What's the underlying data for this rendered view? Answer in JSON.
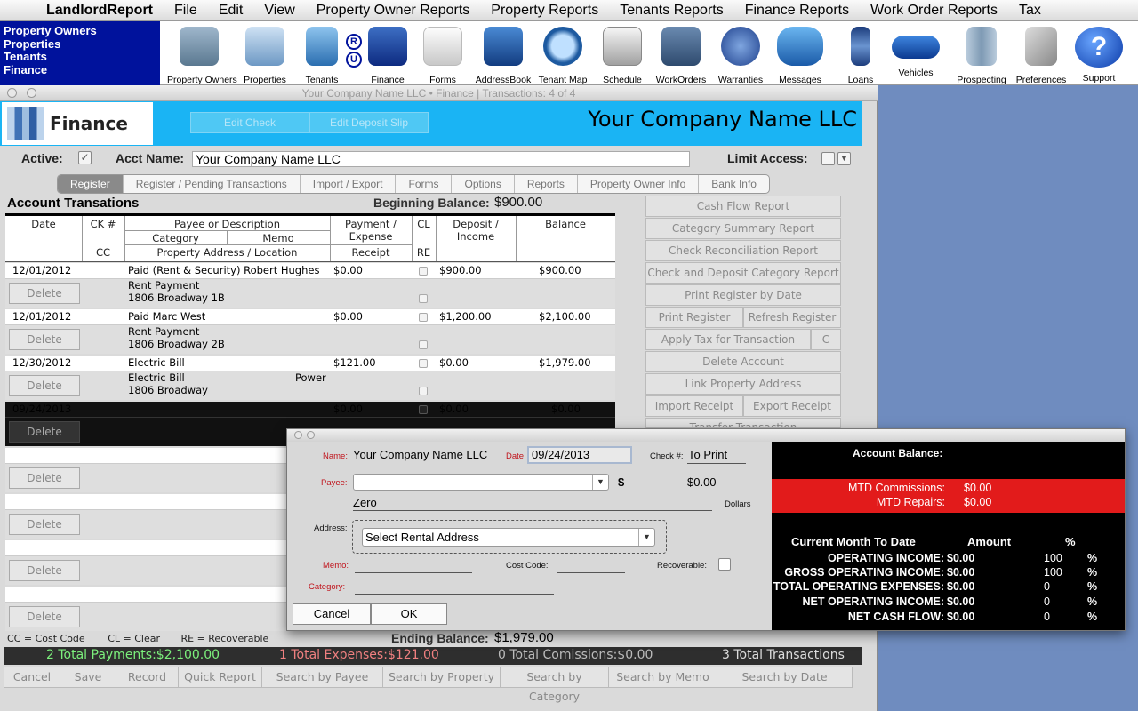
{
  "menubar": {
    "items": [
      "LandlordReport",
      "File",
      "Edit",
      "View",
      "Property Owner Reports",
      "Property Reports",
      "Tenants Reports",
      "Finance Reports",
      "Work Order Reports",
      "Tax"
    ]
  },
  "nav": {
    "items": [
      "Property Owners",
      "Properties",
      "Tenants",
      "Finance"
    ]
  },
  "toolbar": {
    "items": [
      "Property Owners",
      "Properties",
      "Tenants",
      "Finance",
      "Forms",
      "AddressBook",
      "Tenant Map",
      "Schedule",
      "WorkOrders",
      "Warranties",
      "Messages",
      "Loans",
      "Vehicles",
      "Prospecting",
      "Preferences",
      "Support"
    ],
    "ru_badge": [
      "R",
      "U"
    ]
  },
  "window": {
    "title": "Your Company Name LLC  •  Finance | Transactions: 4 of 4"
  },
  "header": {
    "logo_text": "Finance",
    "edit_check": "Edit Check",
    "edit_deposit": "Edit Deposit Slip",
    "company": "Your Company Name LLC"
  },
  "acct": {
    "active_label": "Active:",
    "acct_name_label": "Acct Name:",
    "acct_name": "Your Company Name LLC",
    "limit_label": "Limit Access:",
    "active_check": "✓"
  },
  "tabs": [
    "Register",
    "Register / Pending Transactions",
    "Import / Export",
    "Forms",
    "Options",
    "Reports",
    "Property Owner Info",
    "Bank Info"
  ],
  "register": {
    "title": "Account Transations",
    "beginning_label": "Beginning Balance:",
    "beginning_value": "$900.00",
    "headers": {
      "date": "Date",
      "ck": "CK #",
      "cc": "CC",
      "payee": "Payee or Description",
      "category": "Category",
      "memo": "Memo",
      "address": "Property Address / Location",
      "payment": "Payment /",
      "expense": "Expense",
      "receipt": "Receipt",
      "cl": "CL",
      "re": "RE",
      "deposit": "Deposit /",
      "income": "Income",
      "balance": "Balance"
    },
    "delete_label": "Delete",
    "rows": [
      {
        "date": "12/01/2012",
        "payee": "Paid (Rent & Security) Robert Hughes",
        "payment": "$0.00",
        "deposit": "$900.00",
        "balance": "$900.00",
        "category": "Rent Payment",
        "memo": "",
        "address": "1806 Broadway 1B"
      },
      {
        "date": "12/01/2012",
        "payee": "Paid Marc West",
        "payment": "$0.00",
        "deposit": "$1,200.00",
        "balance": "$2,100.00",
        "category": "Rent Payment",
        "memo": "",
        "address": "1806 Broadway 2B"
      },
      {
        "date": "12/30/2012",
        "payee": "Electric Bill",
        "payment": "$121.00",
        "deposit": "$0.00",
        "balance": "$1,979.00",
        "category": "Electric Bill",
        "memo": "Power",
        "address": "1806 Broadway"
      },
      {
        "date": "09/24/2013",
        "payee": "",
        "payment": "$0.00",
        "deposit": "$0.00",
        "balance": "$0.00",
        "category": "",
        "memo": "",
        "address": ""
      }
    ]
  },
  "right_panel": [
    "Cash Flow Report",
    "Category Summary Report",
    "Check Reconciliation Report",
    "Check and Deposit Category Report",
    "Print Register by Date",
    "Print Register",
    "Refresh Register",
    "Apply Tax for Transaction",
    "C",
    "Delete Account",
    "Link Property Address",
    "Import Receipt",
    "Export Receipt",
    "Transfer Transaction"
  ],
  "footer": {
    "legend_cc": "CC = Cost Code",
    "legend_cl": "CL = Clear",
    "legend_re": "RE = Recoverable",
    "ending_label": "Ending Balance:",
    "ending_value": "$1,979.00",
    "total_payments": "2 Total Payments:$2,100.00",
    "total_expenses": "1 Total Expenses:$121.00",
    "total_comissions": "0 Total Comissions:$0.00",
    "total_transactions": "3 Total Transactions",
    "buttons": [
      "Cancel",
      "Save",
      "Record",
      "Quick Report",
      "Search by Payee",
      "Search by Property",
      "Search by Category",
      "Search by Memo",
      "Search by Date"
    ]
  },
  "dialog": {
    "name_label": "Name:",
    "name_value": "Your Company Name LLC",
    "date_label": "Date",
    "date_value": "09/24/2013",
    "check_label": "Check #:",
    "check_value": "To Print",
    "payee_label": "Payee:",
    "dollar_sign": "$",
    "amount": "$0.00",
    "amount_words": "Zero",
    "dollars_label": "Dollars",
    "address_label": "Address:",
    "address_value": "Select Rental Address",
    "memo_label": "Memo:",
    "cost_code_label": "Cost Code:",
    "recoverable_label": "Recoverable:",
    "category_label": "Category:",
    "cancel": "Cancel",
    "ok": "OK",
    "balance_title": "Account Balance:",
    "mtd_comm_label": "MTD Commissions:",
    "mtd_comm_value": "$0.00",
    "mtd_rep_label": "MTD Repairs:",
    "mtd_rep_value": "$0.00",
    "cmtd_label": "Current Month To Date",
    "amount_label": "Amount",
    "pct_label": "%",
    "rows": [
      {
        "label": "OPERATING INCOME:",
        "amount": "$0.00",
        "pct": "100",
        "sym": "%"
      },
      {
        "label": "GROSS OPERATING INCOME:",
        "amount": "$0.00",
        "pct": "100",
        "sym": "%"
      },
      {
        "label": "TOTAL OPERATING EXPENSES:",
        "amount": "$0.00",
        "pct": "0",
        "sym": "%"
      },
      {
        "label": "NET OPERATING INCOME:",
        "amount": "$0.00",
        "pct": "0",
        "sym": "%"
      },
      {
        "label": "NET CASH FLOW:",
        "amount": "$0.00",
        "pct": "0",
        "sym": "%"
      }
    ]
  },
  "colors": {
    "nav_bg": "#00129c",
    "header_bg": "#1ab4f4",
    "mtd_bar": "#e21b1b",
    "payments": "#7cf07c",
    "expenses": "#f08080"
  }
}
